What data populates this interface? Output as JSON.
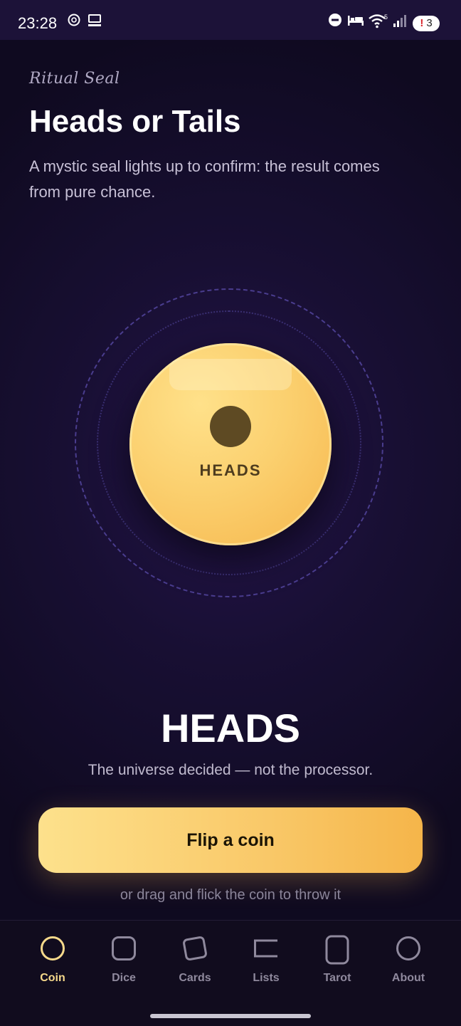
{
  "status_bar": {
    "time": "23:28",
    "left_icons": [
      "openai-icon",
      "desktop-icon"
    ],
    "right_icons": [
      "do-not-disturb-icon",
      "bed-icon",
      "wifi-icon",
      "signal-icon"
    ],
    "wifi_badge": "5",
    "notification_count": "3"
  },
  "header": {
    "eyebrow": "Ritual Seal",
    "title": "Heads or Tails",
    "subtitle": "A mystic seal lights up to confirm: the result comes from pure chance."
  },
  "coin": {
    "face_label": "HEADS"
  },
  "result": {
    "value": "HEADS",
    "caption": "The universe decided — not the processor."
  },
  "actions": {
    "flip_label": "Flip a coin",
    "hint": "or drag and flick the coin to throw it"
  },
  "nav": {
    "items": [
      {
        "label": "Coin",
        "icon": "circle-icon",
        "active": true
      },
      {
        "label": "Dice",
        "icon": "rounded-square-icon",
        "active": false
      },
      {
        "label": "Cards",
        "icon": "tilted-card-icon",
        "active": false
      },
      {
        "label": "Lists",
        "icon": "list-bracket-icon",
        "active": false
      },
      {
        "label": "Tarot",
        "icon": "tall-card-icon",
        "active": false
      },
      {
        "label": "About",
        "icon": "circle-icon",
        "active": false
      }
    ]
  },
  "colors": {
    "accent": "#f9c868",
    "active_nav": "#f6d98b",
    "background": "#180f33"
  }
}
